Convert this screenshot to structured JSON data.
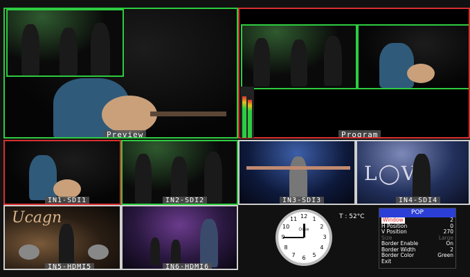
{
  "preview": {
    "label": "Preview"
  },
  "program": {
    "label": "Program"
  },
  "inputs": [
    {
      "label": "IN1-SDI1"
    },
    {
      "label": "IN2-SDI2"
    },
    {
      "label": "IN3-SDI3"
    },
    {
      "label": "IN4-SDI4"
    },
    {
      "label": "IN5-HDMI5"
    },
    {
      "label": "IN6-HDMI6"
    }
  ],
  "clock": {
    "brand": "Osee",
    "numbers": [
      "12",
      "1",
      "2",
      "3",
      "4",
      "5",
      "6",
      "7",
      "8",
      "9",
      "10",
      "11"
    ]
  },
  "temperature": "T : 52°C",
  "pop_menu": {
    "title": "POP",
    "rows": [
      {
        "key": "Window",
        "value": "2",
        "selected": true
      },
      {
        "key": "H Position",
        "value": "0"
      },
      {
        "key": "V Position",
        "value": "270"
      },
      {
        "key": "Size",
        "value": "Large",
        "disabled": true
      },
      {
        "key": "Border Enable",
        "value": "On"
      },
      {
        "key": "Border Width",
        "value": "2"
      },
      {
        "key": "Border Color",
        "value": "Green"
      },
      {
        "key": "Exit",
        "value": ""
      }
    ]
  }
}
